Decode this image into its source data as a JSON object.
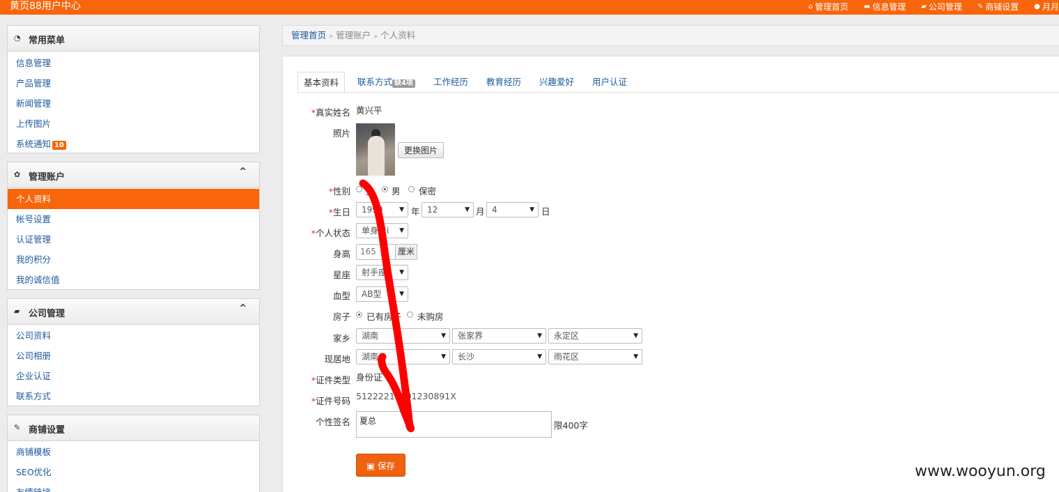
{
  "topbar": {
    "brand": "黄页88用户中心",
    "nav": [
      {
        "icon": "home-icon",
        "glyph": "⌂",
        "label": "管理首页"
      },
      {
        "icon": "folder-icon",
        "glyph": "▬",
        "label": "信息管理"
      },
      {
        "icon": "company-icon",
        "glyph": "▰",
        "label": "公司管理"
      },
      {
        "icon": "wrench-icon",
        "glyph": "✎",
        "label": "商铺设置"
      },
      {
        "icon": "user-icon",
        "glyph": "●",
        "label": "月月"
      }
    ]
  },
  "sidebar": {
    "common": {
      "icon": "dashboard-icon",
      "glyph": "◔",
      "title": "常用菜单",
      "items": [
        "信息管理",
        "产品管理",
        "新闻管理",
        "上传图片",
        "系统通知"
      ],
      "notify_badge": "10"
    },
    "account": {
      "icon": "gear-icon",
      "glyph": "✿",
      "title": "管理账户",
      "collapse": "^",
      "items": [
        "个人资料",
        "帐号设置",
        "认证管理",
        "我的积分",
        "我的诚信值"
      ]
    },
    "company": {
      "icon": "company-icon",
      "glyph": "▰",
      "title": "公司管理",
      "collapse": "^",
      "items": [
        "公司资料",
        "公司相册",
        "企业认证",
        "联系方式"
      ]
    },
    "shop": {
      "icon": "wrench-icon",
      "glyph": "✎",
      "title": "商铺设置",
      "items": [
        "商铺模板",
        "SEO优化",
        "友情链接"
      ]
    }
  },
  "breadcrumb": {
    "home": "管理首页",
    "sep": "»",
    "account": "管理账户",
    "current": "个人资料"
  },
  "tabs": [
    {
      "label": "基本资料"
    },
    {
      "label": "联系方式",
      "badge": "缺4项"
    },
    {
      "label": "工作经历"
    },
    {
      "label": "教育经历"
    },
    {
      "label": "兴趣爱好"
    },
    {
      "label": "用户认证"
    }
  ],
  "form": {
    "required_mark": "*",
    "name": {
      "label": "真实姓名",
      "value": "黄兴平"
    },
    "photo": {
      "label": "照片",
      "button": "更换图片"
    },
    "gender": {
      "label": "性别",
      "options": [
        "女",
        "男",
        "保密"
      ],
      "selected": "男"
    },
    "birthday": {
      "label": "生日",
      "year": "1990",
      "year_unit": "年",
      "month": "12",
      "month_unit": "月",
      "day": "4",
      "day_unit": "日"
    },
    "status": {
      "label": "个人状态",
      "value": "单身贵i"
    },
    "height": {
      "label": "身高",
      "value": "165",
      "unit": "厘米"
    },
    "zodiac": {
      "label": "星座",
      "value": "射手座"
    },
    "blood": {
      "label": "血型",
      "value": "AB型"
    },
    "house": {
      "label": "房子",
      "options": [
        "已有房子",
        "未购房"
      ],
      "selected": "已有房子"
    },
    "hometown": {
      "label": "家乡",
      "province": "湖南",
      "city": "张家界",
      "district": "永定区"
    },
    "residence": {
      "label": "现居地",
      "province": "湖南",
      "city": "长沙",
      "district": "雨花区"
    },
    "id_type": {
      "label": "证件类型",
      "value": "身份证"
    },
    "id_number": {
      "label": "证件号码",
      "value": "51222219891230891X"
    },
    "signature": {
      "label": "个性签名",
      "value": "夏总",
      "limit": "限400字"
    },
    "save": {
      "icon": "save-icon",
      "glyph": "▣",
      "label": "保存"
    }
  },
  "watermark": "www.wooyun.org",
  "colors": {
    "brand": "#f8650a",
    "link": "#1a5a9e",
    "annotation": "#ff0000"
  }
}
